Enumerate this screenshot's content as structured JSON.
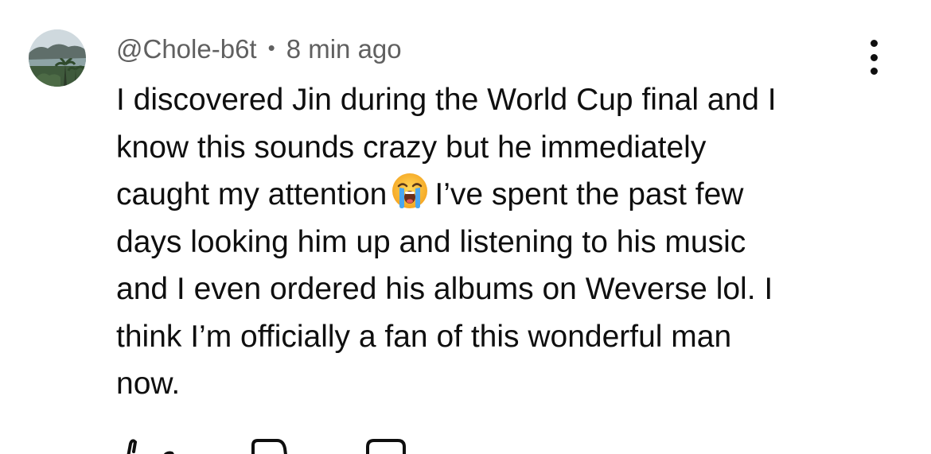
{
  "comment": {
    "username": "@Chole-b6t",
    "separator": "•",
    "timestamp": "8 min ago",
    "lines": [
      "I discovered Jin during the World Cup final and I",
      "know this sounds crazy but he immediately",
      "caught my attention",
      "I’ve spent the past few",
      "days looking him up and listening to his music",
      "and I even ordered his albums on Weverse lol. I",
      "think I’m officially a fan of this wonderful man",
      "now."
    ],
    "emoji": "loudly-crying-face-emoji"
  },
  "icons": {
    "avatar": "avatar",
    "more": "more-vert-icon",
    "like": "thumb-up-icon",
    "dislike": "thumb-down-icon",
    "reply": "reply-icon"
  },
  "colors": {
    "text": "#0f0f0f",
    "meta": "#606060",
    "background": "#ffffff"
  }
}
